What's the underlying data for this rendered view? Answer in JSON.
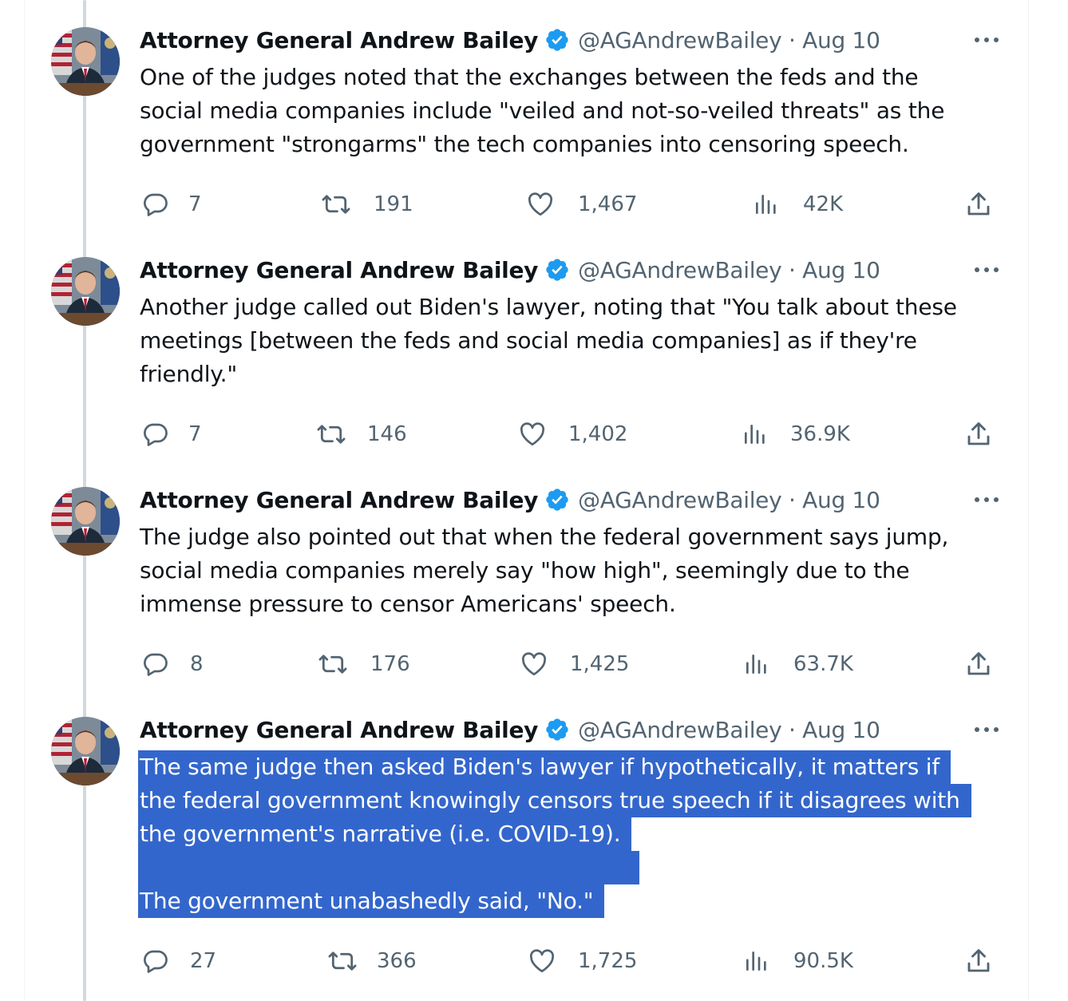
{
  "colors": {
    "text": "#0f1419",
    "secondary": "#536471",
    "verified": "#1d9bf0",
    "selection": "#3366cc",
    "thread_line": "#cfd9de"
  },
  "tweets": [
    {
      "author": "Attorney General Andrew Bailey",
      "handle_date": "@AGAndrewBailey · Aug 10",
      "text_lines": [
        "One of the judges noted that the exchanges between the feds and the",
        "social media companies include \"veiled and not-so-veiled threats\" as the",
        "government \"strongarms\" the tech companies into censoring speech."
      ],
      "replies": "7",
      "reposts": "191",
      "likes": "1,467",
      "views": "42K"
    },
    {
      "author": "Attorney General Andrew Bailey",
      "handle_date": "@AGAndrewBailey · Aug 10",
      "text_lines": [
        "Another judge called out Biden's lawyer, noting that \"You talk about these",
        "meetings [between the feds and social media companies] as if they're",
        "friendly.\""
      ],
      "replies": "7",
      "reposts": "146",
      "likes": "1,402",
      "views": "36.9K"
    },
    {
      "author": "Attorney General Andrew Bailey",
      "handle_date": "@AGAndrewBailey · Aug 10",
      "text_lines": [
        "The judge also pointed out that when the federal government says jump,",
        "social media companies merely say \"how high\", seemingly due to the",
        "immense pressure to censor Americans' speech."
      ],
      "replies": "8",
      "reposts": "176",
      "likes": "1,425",
      "views": "63.7K"
    },
    {
      "author": "Attorney General Andrew Bailey",
      "handle_date": "@AGAndrewBailey · Aug 10",
      "text_lines": [
        "The same judge then asked Biden's lawyer if hypothetically, it matters if",
        "the federal government knowingly censors true speech if it disagrees with",
        "the government's narrative (i.e. COVID-19).",
        "The government unabashedly said, \"No.\""
      ],
      "replies": "27",
      "reposts": "366",
      "likes": "1,725",
      "views": "90.5K"
    }
  ]
}
